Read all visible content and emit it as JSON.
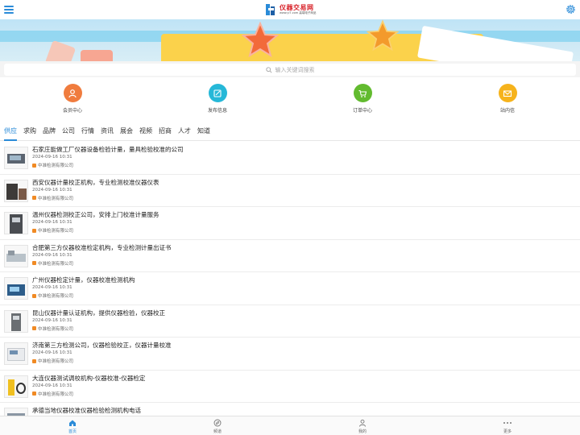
{
  "header": {
    "logo_title": "仪器交易网",
    "logo_subtitle": "www.yi7.com 高端电子商品"
  },
  "search": {
    "placeholder": "输入关键词搜索"
  },
  "quick_links": [
    {
      "label": "会员中心",
      "icon": "person-icon",
      "color": "#f07c3e"
    },
    {
      "label": "发布信息",
      "icon": "edit-icon",
      "color": "#26b8d8"
    },
    {
      "label": "订单中心",
      "icon": "cart-icon",
      "color": "#62bb2f"
    },
    {
      "label": "站内信",
      "icon": "mail-icon",
      "color": "#f6b31c"
    }
  ],
  "tabs": [
    "供应",
    "求购",
    "品牌",
    "公司",
    "行情",
    "资讯",
    "展会",
    "视频",
    "招商",
    "人才",
    "知道"
  ],
  "active_tab": "供应",
  "list": [
    {
      "title": "石家庄能做工厂仪器设备检验计量，量具检验校准的公司",
      "date": "2024-09-16 10:31",
      "company": "中准检测有限公司"
    },
    {
      "title": "西安仪器计量校正机构，专业检测校准仪器仪表",
      "date": "2024-09-16 10:31",
      "company": "中准检测有限公司"
    },
    {
      "title": "温州仪器检测校正公司，安排上门校准计量服务",
      "date": "2024-09-16 10:31",
      "company": "中准检测有限公司"
    },
    {
      "title": "合肥第三方仪器校准检定机构，专业检测计量出证书",
      "date": "2024-09-16 10:31",
      "company": "中准检测有限公司"
    },
    {
      "title": "广州仪器检定计量，仪器校准检测机构",
      "date": "2024-09-16 10:31",
      "company": "中准检测有限公司"
    },
    {
      "title": "昆山仪器计量认证机构，提供仪器检验，仪器校正",
      "date": "2024-09-16 10:31",
      "company": "中准检测有限公司"
    },
    {
      "title": "济南第三方检测公司，仪器检验校正，仪器计量校准",
      "date": "2024-09-16 10:31",
      "company": "中准检测有限公司"
    },
    {
      "title": "大连仪器测试调校机构-仪器校准-仪器检定",
      "date": "2024-09-16 10:31",
      "company": "中准检测有限公司"
    },
    {
      "title": "承德当地仪器校准仪器检验检测机构电话",
      "date": "",
      "company": ""
    }
  ],
  "bottom_nav": [
    {
      "label": "首页",
      "icon": "home-icon",
      "active": true
    },
    {
      "label": "频道",
      "icon": "compass-icon",
      "active": false
    },
    {
      "label": "我的",
      "icon": "user-icon",
      "active": false
    },
    {
      "label": "更多",
      "icon": "more-icon",
      "active": false
    }
  ],
  "colors": {
    "accent": "#2a8bd8",
    "logo_red": "#d8232a"
  }
}
